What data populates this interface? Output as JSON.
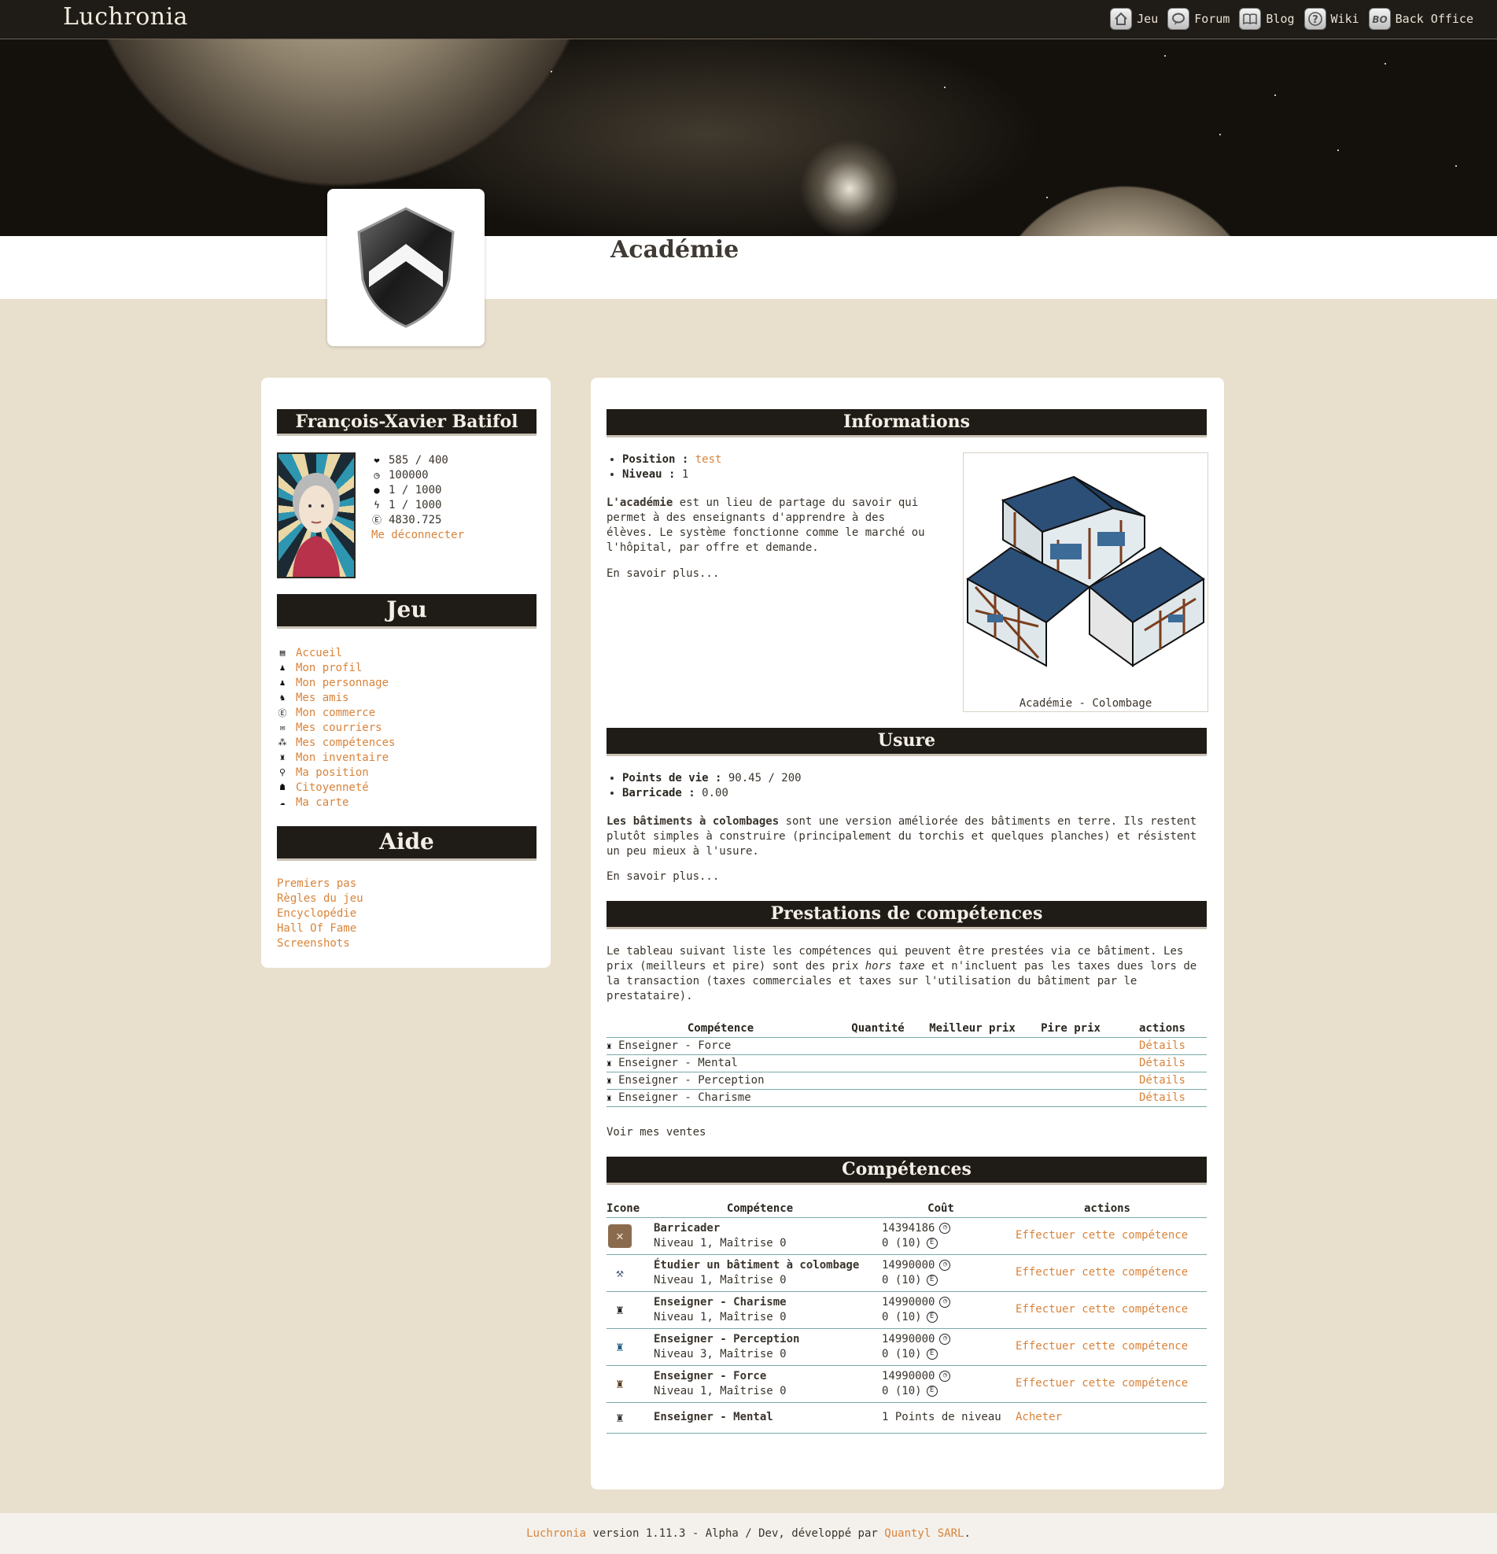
{
  "topbar": {
    "logo": "Luchronia",
    "nav": [
      {
        "label": "Jeu",
        "icon": "home-icon"
      },
      {
        "label": "Forum",
        "icon": "speech-bubble-icon"
      },
      {
        "label": "Blog",
        "icon": "book-icon"
      },
      {
        "label": "Wiki",
        "icon": "question-icon"
      },
      {
        "label": "Back Office",
        "icon": "bo-badge-icon"
      }
    ]
  },
  "page": {
    "title": "Académie"
  },
  "sidebar": {
    "character_name": "François-Xavier Batifol",
    "stats": [
      {
        "icon": "heart-icon",
        "value": "585 / 400"
      },
      {
        "icon": "clock-icon",
        "value": "100000"
      },
      {
        "icon": "drop-icon",
        "value": "1 / 1000"
      },
      {
        "icon": "lightning-icon",
        "value": "1 / 1000"
      },
      {
        "icon": "currency-icon",
        "value": "4830.725"
      }
    ],
    "logout": "Me déconnecter",
    "game_heading": "Jeu",
    "game_menu": [
      {
        "label": "Accueil",
        "icon": "list-icon"
      },
      {
        "label": "Mon profil",
        "icon": "person-icon"
      },
      {
        "label": "Mon personnage",
        "icon": "person-icon"
      },
      {
        "label": "Mes amis",
        "icon": "friends-icon"
      },
      {
        "label": "Mon commerce",
        "icon": "currency-icon"
      },
      {
        "label": "Mes courriers",
        "icon": "envelope-icon"
      },
      {
        "label": "Mes compétences",
        "icon": "skills-icon"
      },
      {
        "label": "Mon inventaire",
        "icon": "bag-icon"
      },
      {
        "label": "Ma position",
        "icon": "pin-icon"
      },
      {
        "label": "Citoyenneté",
        "icon": "citizen-icon"
      },
      {
        "label": "Ma carte",
        "icon": "map-icon"
      }
    ],
    "help_heading": "Aide",
    "help_menu": [
      "Premiers pas",
      "Règles du jeu",
      "Encyclopédie",
      "Hall Of Fame",
      "Screenshots"
    ]
  },
  "info": {
    "heading": "Informations",
    "position_label": "Position :",
    "position_value": "test",
    "level_label": "Niveau :",
    "level_value": "1",
    "desc_bold": "L'académie",
    "desc_rest": " est un lieu de partage du savoir qui permet à des enseignants d'apprendre à des élèves. Le système fonctionne comme le marché ou l'hôpital, par offre et demande.",
    "more": "En savoir plus...",
    "image_caption": "Académie - Colombage"
  },
  "usure": {
    "heading": "Usure",
    "hp_label": "Points de vie :",
    "hp_value": "90.45 / 200",
    "barricade_label": "Barricade :",
    "barricade_value": "0.00",
    "desc_bold": "Les bâtiments à colombages",
    "desc_rest": " sont une version améliorée des bâtiments en terre. Ils restent plutôt simples à construire (principalement du torchis et quelques planches) et résistent un peu mieux à l'usure.",
    "more": "En savoir plus..."
  },
  "prestations": {
    "heading": "Prestations de compétences",
    "desc_a": "Le tableau suivant liste les compétences qui peuvent être prestées via ce bâtiment. Les prix (meilleurs et pire) sont des prix ",
    "desc_em": "hors taxe",
    "desc_b": " et n'incluent pas les taxes dues lors de la transaction (taxes commerciales et taxes sur l'utilisation du bâtiment par le prestataire).",
    "columns": [
      "Compétence",
      "Quantité",
      "Meilleur prix",
      "Pire prix",
      "actions"
    ],
    "rows": [
      {
        "name": "Enseigner - Force",
        "action": "Détails"
      },
      {
        "name": "Enseigner - Mental",
        "action": "Détails"
      },
      {
        "name": "Enseigner - Perception",
        "action": "Détails"
      },
      {
        "name": "Enseigner - Charisme",
        "action": "Détails"
      }
    ],
    "sales_link": "Voir mes ventes"
  },
  "competences": {
    "heading": "Compétences",
    "columns": [
      "Icone",
      "Compétence",
      "Coût",
      "actions"
    ],
    "rows": [
      {
        "icon": "barricade-icon",
        "name": "Barricader",
        "level": "Niveau 1, Maîtrise 0",
        "time": "14394186",
        "money": "0 (10)",
        "action": "Effectuer cette compétence"
      },
      {
        "icon": "study-building-icon",
        "name": "Étudier un bâtiment à colombage",
        "level": "Niveau 1, Maîtrise 0",
        "time": "14990000",
        "money": "0 (10)",
        "action": "Effectuer cette compétence"
      },
      {
        "icon": "teach-charisma-icon",
        "name": "Enseigner - Charisme",
        "level": "Niveau 1, Maîtrise 0",
        "time": "14990000",
        "money": "0 (10)",
        "action": "Effectuer cette compétence"
      },
      {
        "icon": "teach-perception-icon",
        "name": "Enseigner - Perception",
        "level": "Niveau 3, Maîtrise 0",
        "time": "14990000",
        "money": "0 (10)",
        "action": "Effectuer cette compétence"
      },
      {
        "icon": "teach-force-icon",
        "name": "Enseigner - Force",
        "level": "Niveau 1, Maîtrise 0",
        "time": "14990000",
        "money": "0 (10)",
        "action": "Effectuer cette compétence"
      }
    ],
    "last_row": {
      "icon": "teach-mental-icon",
      "name": "Enseigner - Mental",
      "cost": "1 Points de niveau",
      "action": "Acheter"
    }
  },
  "footer": {
    "brand": "Luchronia",
    "text": " version 1.11.3 - Alpha / Dev, développé par ",
    "company": "Quantyl SARL",
    "end": "."
  }
}
